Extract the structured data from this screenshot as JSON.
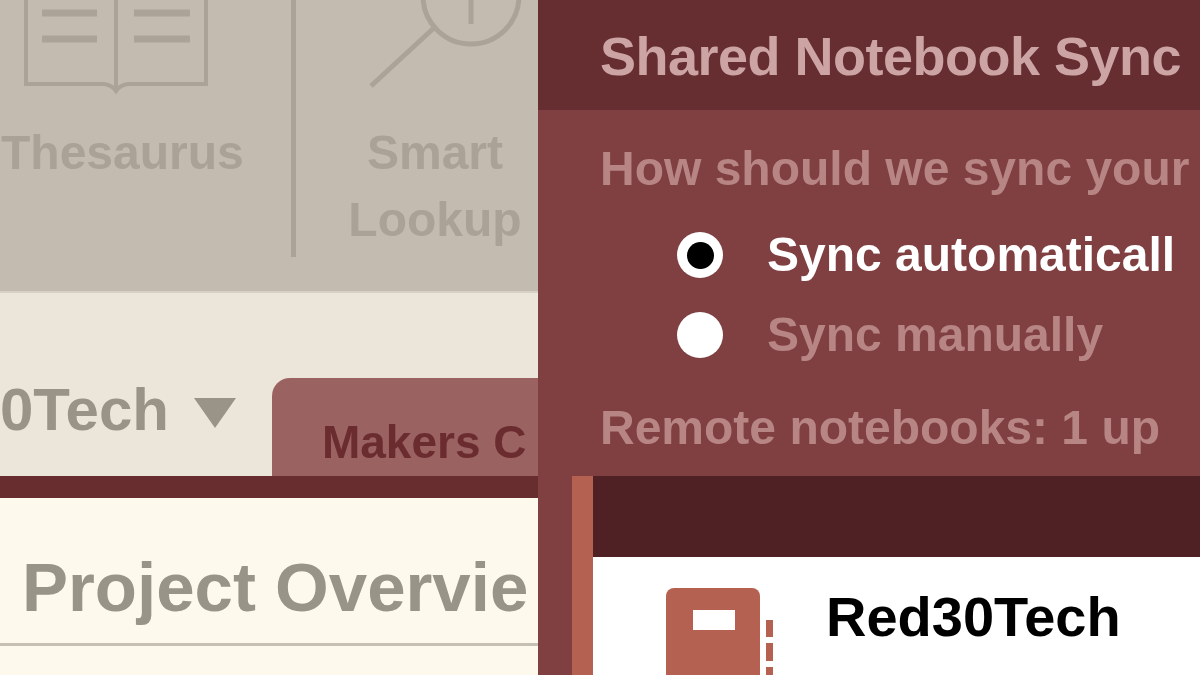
{
  "ribbon": {
    "buttons": [
      {
        "kind": "thesaurus",
        "label": "Thesaurus"
      },
      {
        "kind": "lookup",
        "label": "Smart Lookup"
      }
    ]
  },
  "notebook_bar": {
    "notebook_name": "0Tech",
    "sections": [
      {
        "label": "Makers C",
        "selected": true
      }
    ]
  },
  "page": {
    "title": "Project Overvie"
  },
  "dialog": {
    "title": "Shared Notebook Sync",
    "question": "How should we sync your",
    "options": [
      {
        "label": "Sync automaticall",
        "selected": true
      },
      {
        "label": "Sync manually",
        "selected": false
      }
    ],
    "status": "Remote notebooks: 1 up",
    "notebooks": [
      {
        "name": "Red30Tech"
      }
    ]
  }
}
